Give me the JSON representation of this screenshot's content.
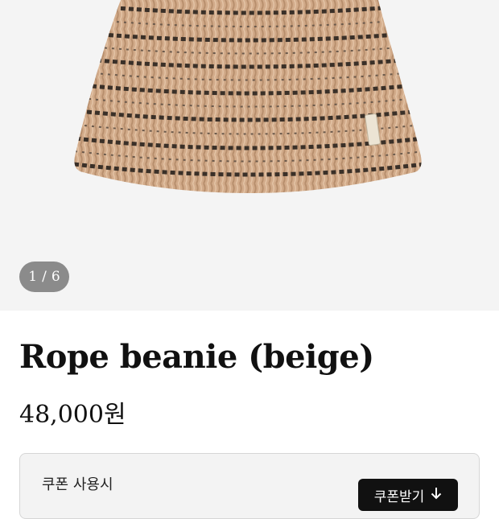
{
  "gallery": {
    "current": "1",
    "separator": "/",
    "total": "6"
  },
  "product": {
    "name": "Rope beanie (beige)",
    "price": "48,000원"
  },
  "coupon": {
    "label": "쿠폰 사용시",
    "button_label": "쿠폰받기",
    "button_icon": "arrow-down-icon"
  },
  "colors": {
    "hero_bg": "#f4f4f4",
    "knit_base": "#c9a07e",
    "knit_stripe": "#3a3028",
    "counter_bg": "#8b8b8b",
    "button_bg": "#111111"
  }
}
